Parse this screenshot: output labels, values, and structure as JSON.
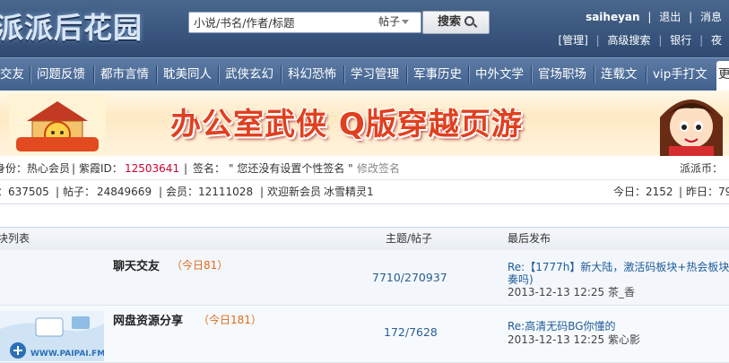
{
  "header": {
    "logo_text": "派派后花园",
    "search_placeholder": "小说/书名/作者/标题",
    "search_type": "帖子",
    "search_button": "搜索",
    "user": {
      "username": "saiheyan",
      "logout": "退出",
      "messages": "消息",
      "admin": "[管理]",
      "advanced_search": "高级搜索",
      "bank": "银行",
      "more": "夜"
    }
  },
  "nav": {
    "items": [
      "交友",
      "问题反馈",
      "都市言情",
      "耽美同人",
      "武侠玄幻",
      "科幻恐怖",
      "学习管理",
      "军事历史",
      "中外文学",
      "官场职场",
      "连载文",
      "vip手打文",
      "更"
    ]
  },
  "banner": {
    "left_logo": "派派精灵",
    "text": "办公室武侠  Q版穿越页游"
  },
  "profile": {
    "identity_label": "身份：",
    "identity_value": "热心会员",
    "ziyin_label": "紫霞ID：",
    "ziyin_value": "12503641",
    "sig_label": "签名：",
    "sig_value": "\" 您还没有设置个性签名 \"",
    "edit_sig": "修改签名",
    "coin_label": "派派币："
  },
  "stats": {
    "topics_tail": "：637505",
    "posts_label": "帖子：",
    "posts_value": "24849669",
    "members_label": "会员：",
    "members_value": "12111028",
    "welcome": "欢迎新会员",
    "newest_member": "冰雪精灵1",
    "today_label": "今日：",
    "today_value": "2152",
    "yesterday_label": "昨日：",
    "yesterday_value": "79"
  },
  "table": {
    "header_forum": "块列表",
    "header_stats": "主题/帖子",
    "header_last": "最后发布",
    "rows": [
      {
        "name": "聊天交友",
        "today": "（今日81）",
        "stats": "7710/270937",
        "last_title": "Re:【1777h】新大陆，激活码板块+热会板块",
        "last_title2": "奏吗)",
        "last_time": "2013-12-13 12:25",
        "last_user": "茶_香"
      },
      {
        "name": "网盘资源分享",
        "today": "（今日181）",
        "stats": "172/7628",
        "last_title": "Re:高清无码BG你懂的",
        "last_time": "2013-12-13 12:25",
        "last_user": "紫心影",
        "thumb_text": "WWW.PAIPAI.FM"
      }
    ]
  },
  "colors": {
    "header_bg": "#3d5a83",
    "nav_bg": "#4f6f9a",
    "accent_red": "#cc0033",
    "link_blue": "#1d5a99",
    "today_orange": "#e06a1b"
  }
}
